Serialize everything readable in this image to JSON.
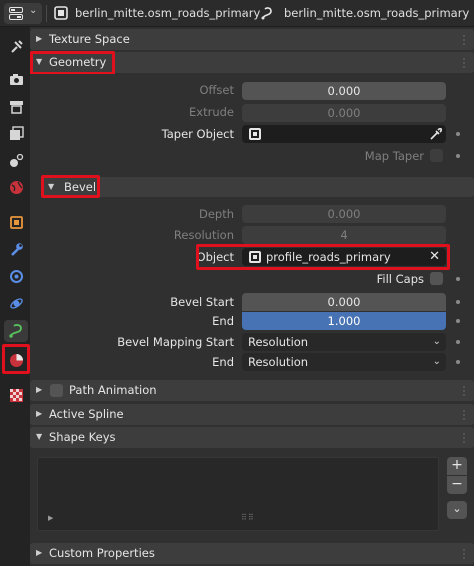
{
  "header": {
    "editor_type_icon": "properties-editor-icon",
    "object_name": "berlin_mitte.osm_roads_primary",
    "data_name": "berlin_mitte.osm_roads_primary"
  },
  "tabs": [
    {
      "icon": "tool-icon"
    },
    {
      "icon": "render-icon"
    },
    {
      "icon": "output-icon"
    },
    {
      "icon": "view-layer-icon"
    },
    {
      "icon": "scene-icon"
    },
    {
      "icon": "world-icon"
    },
    {
      "icon": "object-icon"
    },
    {
      "icon": "modifier-icon"
    },
    {
      "icon": "particles-icon"
    },
    {
      "icon": "physics-icon"
    },
    {
      "icon": "curve-data-icon",
      "active": true
    },
    {
      "icon": "material-icon"
    },
    {
      "icon": "texture-icon"
    }
  ],
  "panels": {
    "texture_space": "Texture Space",
    "geometry": "Geometry",
    "bevel": "Bevel",
    "path_animation": "Path Animation",
    "active_spline": "Active Spline",
    "shape_keys": "Shape Keys",
    "custom_properties": "Custom Properties"
  },
  "geometry": {
    "offset_label": "Offset",
    "offset_value": "0.000",
    "extrude_label": "Extrude",
    "extrude_value": "0.000",
    "taper_object_label": "Taper Object",
    "taper_object_value": "",
    "map_taper_label": "Map Taper",
    "map_taper_checked": false
  },
  "bevel": {
    "depth_label": "Depth",
    "depth_value": "0.000",
    "resolution_label": "Resolution",
    "resolution_value": "4",
    "object_label": "Object",
    "object_value": "profile_roads_primary",
    "fill_caps_label": "Fill Caps",
    "fill_caps_checked": false,
    "bevel_start_label": "Bevel Start",
    "bevel_start_value": "0.000",
    "end_label": "End",
    "end_value": "1.000",
    "mapping_start_label": "Bevel Mapping Start",
    "mapping_start_value": "Resolution",
    "mapping_end_label": "End",
    "mapping_end_value": "Resolution"
  },
  "colors": {
    "accent_blue": "#4772b3",
    "highlight_red": "#e0101d",
    "active_tab_icon": "#58c25e"
  }
}
